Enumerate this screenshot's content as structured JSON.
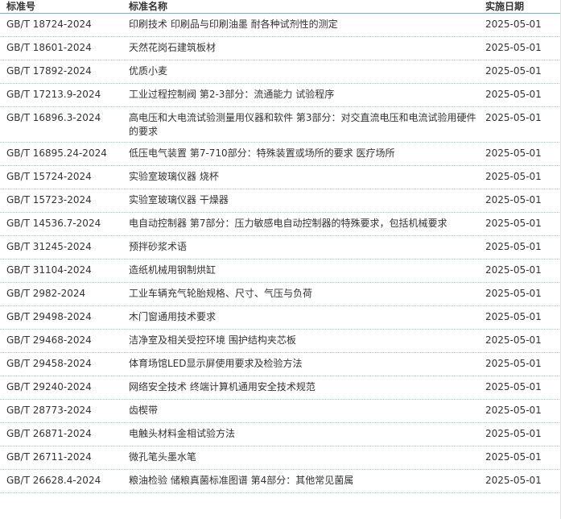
{
  "table": {
    "headers": {
      "code": "标准号",
      "name": "标准名称",
      "date": "实施日期"
    },
    "rows": [
      {
        "code": "GB/T 18724-2024",
        "name": "印刷技术 印刷品与印刷油墨 耐各种试剂性的测定",
        "date": "2025-05-01"
      },
      {
        "code": "GB/T 18601-2024",
        "name": "天然花岗石建筑板材",
        "date": "2025-05-01"
      },
      {
        "code": "GB/T 17892-2024",
        "name": "优质小麦",
        "date": "2025-05-01"
      },
      {
        "code": "GB/T 17213.9-2024",
        "name": "工业过程控制阀 第2-3部分：流通能力 试验程序",
        "date": "2025-05-01"
      },
      {
        "code": "GB/T 16896.3-2024",
        "name": "高电压和大电流试验测量用仪器和软件 第3部分：对交直流电压和电流试验用硬件的要求",
        "date": "2025-05-01"
      },
      {
        "code": "GB/T 16895.24-2024",
        "name": "低压电气装置 第7-710部分：特殊装置或场所的要求 医疗场所",
        "date": "2025-05-01"
      },
      {
        "code": "GB/T 15724-2024",
        "name": "实验室玻璃仪器 烧杯",
        "date": "2025-05-01"
      },
      {
        "code": "GB/T 15723-2024",
        "name": "实验室玻璃仪器 干燥器",
        "date": "2025-05-01"
      },
      {
        "code": "GB/T 14536.7-2024",
        "name": "电自动控制器 第7部分：压力敏感电自动控制器的特殊要求，包括机械要求",
        "date": "2025-05-01"
      },
      {
        "code": "GB/T 31245-2024",
        "name": "预拌砂浆术语",
        "date": "2025-05-01"
      },
      {
        "code": "GB/T 31104-2024",
        "name": "造纸机械用钢制烘缸",
        "date": "2025-05-01"
      },
      {
        "code": "GB/T 2982-2024",
        "name": "工业车辆充气轮胎规格、尺寸、气压与负荷",
        "date": "2025-05-01"
      },
      {
        "code": "GB/T 29498-2024",
        "name": "木门窗通用技术要求",
        "date": "2025-05-01"
      },
      {
        "code": "GB/T 29468-2024",
        "name": "洁净室及相关受控环境 围护结构夹芯板",
        "date": "2025-05-01"
      },
      {
        "code": "GB/T 29458-2024",
        "name": "体育场馆LED显示屏使用要求及检验方法",
        "date": "2025-05-01"
      },
      {
        "code": "GB/T 29240-2024",
        "name": "网络安全技术 终端计算机通用安全技术规范",
        "date": "2025-05-01"
      },
      {
        "code": "GB/T 28773-2024",
        "name": "齿楔带",
        "date": "2025-05-01"
      },
      {
        "code": "GB/T 26871-2024",
        "name": "电触头材料金相试验方法",
        "date": "2025-05-01"
      },
      {
        "code": "GB/T 26711-2024",
        "name": "微孔笔头墨水笔",
        "date": "2025-05-01"
      },
      {
        "code": "GB/T 26628.4-2024",
        "name": "粮油检验 储粮真菌标准图谱 第4部分：其他常见菌属",
        "date": "2025-05-01"
      }
    ]
  }
}
